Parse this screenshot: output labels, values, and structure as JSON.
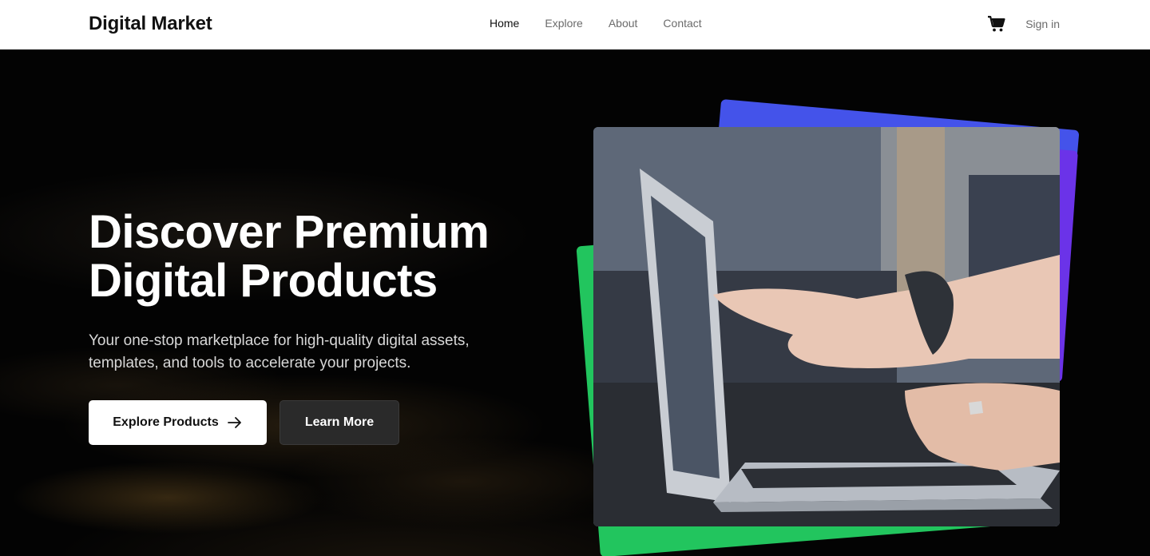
{
  "nav": {
    "brand": "Digital Market",
    "links": [
      {
        "label": "Home",
        "active": true
      },
      {
        "label": "Explore",
        "active": false
      },
      {
        "label": "About",
        "active": false
      },
      {
        "label": "Contact",
        "active": false
      }
    ],
    "cart_icon": "cart-icon",
    "signin_label": "Sign in"
  },
  "hero": {
    "headline_line1": "Discover Premium",
    "headline_line2": "Digital Products",
    "subtext": "Your one-stop marketplace for high-quality digital assets, templates, and tools to accelerate your projects.",
    "primary_button": "Explore Products",
    "primary_button_icon": "arrow-right-icon",
    "secondary_button": "Learn More"
  },
  "colors": {
    "accent_green": "#22c55e",
    "accent_blue": "#4453ea",
    "accent_purple": "#6b33e8",
    "hero_background": "#030303"
  }
}
